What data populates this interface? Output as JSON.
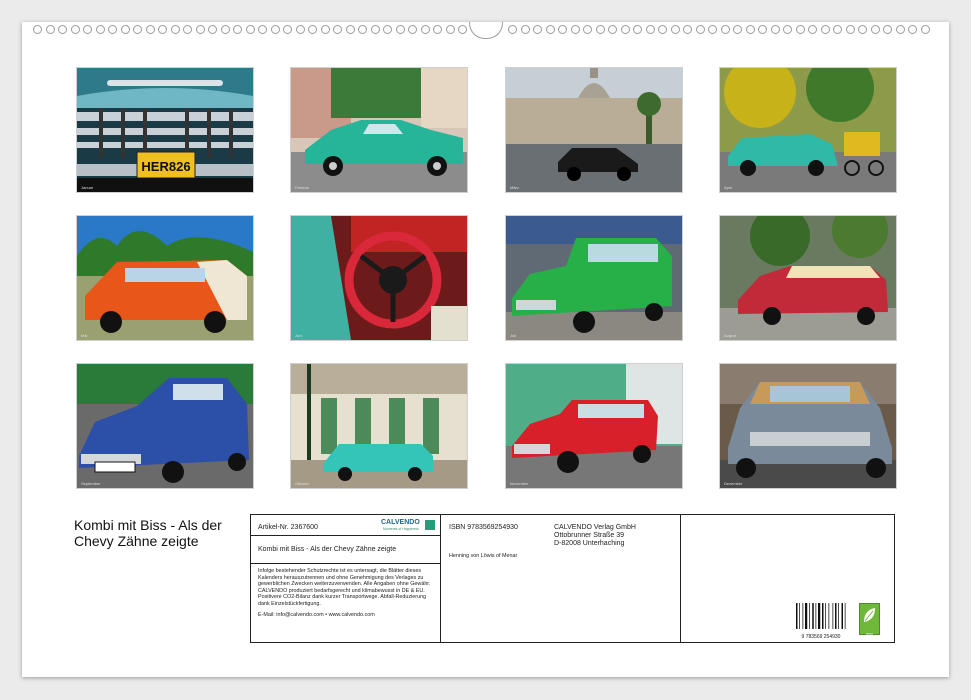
{
  "calendar": {
    "title": "Kombi mit Biss - Als der Chevy Zähne zeigte",
    "months": [
      {
        "caption": "Januar",
        "scene": "grille",
        "plate": "HER826"
      },
      {
        "caption": "Februar",
        "scene": "street-teal"
      },
      {
        "caption": "März",
        "scene": "capitol"
      },
      {
        "caption": "April",
        "scene": "park-teal"
      },
      {
        "caption": "Mai",
        "scene": "orange-wagon"
      },
      {
        "caption": "Juni",
        "scene": "interior"
      },
      {
        "caption": "Juli",
        "scene": "green-wagon"
      },
      {
        "caption": "August",
        "scene": "red-cream"
      },
      {
        "caption": "September",
        "scene": "blue-wagon"
      },
      {
        "caption": "Oktober",
        "scene": "colonnade-teal"
      },
      {
        "caption": "November",
        "scene": "red-wagon"
      },
      {
        "caption": "Dezember",
        "scene": "woody"
      }
    ]
  },
  "info": {
    "article_label": "Artikel-Nr. 2367600",
    "brand": "CALVENDO",
    "brand_tag": "Moments of Happiness",
    "product_title": "Kombi mit Biss - Als der Chevy Zähne zeigte",
    "legal": "Infolge bestehender Schutzrechte ist es untersagt, die Blätter dieses Kalenders herauszutrennen und ohne Genehmigung des Verlages zu gewerblichen Zwecken weiterzuverwenden. Alle Angaben ohne Gewähr. CALVENDO produziert bedarfsgerecht und klimabewusst in DE & EU. Positivere CO2-Bilanz dank kurzer Transportwege. Abfall-Reduzierung dank Einzelstückfertigung.",
    "contact": "E-Mail: info@calvendo.com • www.calvendo.com",
    "isbn": "ISBN 9783569254930",
    "author": "Henning von Löwis of Menar",
    "publisher": [
      "CALVENDO Verlag GmbH",
      "Ottobrunner Straße 39",
      "D-82008 Unterhaching"
    ],
    "barcode_number": "9 783569 254930",
    "eco_label": "eco"
  }
}
